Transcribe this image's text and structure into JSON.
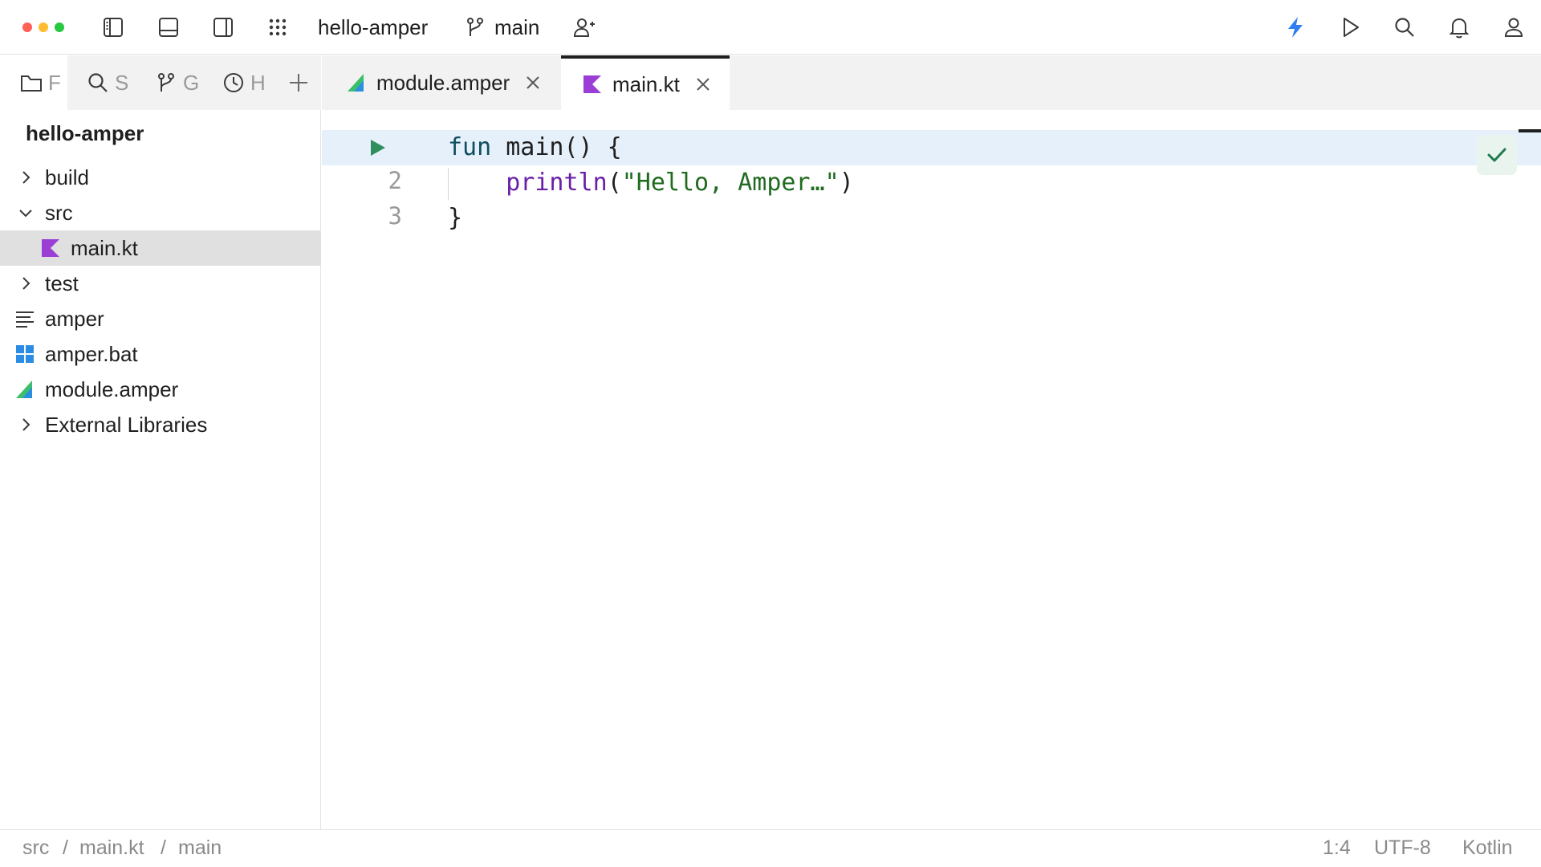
{
  "titlebar": {
    "project_name": "hello-amper",
    "branch": "main",
    "traffic_colors": [
      "#ff5f57",
      "#febc2e",
      "#28c840"
    ],
    "icons": [
      "toggle-left-panel-icon",
      "toggle-bottom-panel-icon",
      "toggle-right-panel-icon",
      "main-menu-grid-icon",
      "git-branch-icon",
      "add-user-icon",
      "ai-lightning-icon",
      "run-icon",
      "search-icon",
      "notifications-bell-icon",
      "account-icon"
    ],
    "accent_color": "#2f7ff2"
  },
  "tool_window_tabs": [
    {
      "label": "F",
      "icon": "folder-icon"
    },
    {
      "label": "S",
      "icon": "search-icon"
    },
    {
      "label": "G",
      "icon": "git-icon"
    },
    {
      "label": "H",
      "icon": "history-clock-icon"
    }
  ],
  "project_tree": {
    "title": "hello-amper",
    "items": [
      {
        "label": "build",
        "icon": "chevron-right-icon"
      },
      {
        "label": "src",
        "icon": "chevron-down-icon"
      },
      {
        "label": "main.kt",
        "icon": "kotlin-file-icon"
      },
      {
        "label": "test",
        "icon": "chevron-right-icon"
      },
      {
        "label": "amper",
        "icon": "text-file-icon"
      },
      {
        "label": "amper.bat",
        "icon": "windows-file-icon"
      },
      {
        "label": "module.amper",
        "icon": "amper-file-icon"
      },
      {
        "label": "External Libraries",
        "icon": "chevron-right-icon"
      }
    ]
  },
  "editor_tabs": [
    {
      "label": "module.amper",
      "icon": "amper-file-icon",
      "active": false
    },
    {
      "label": "main.kt",
      "icon": "kotlin-file-icon",
      "active": true
    }
  ],
  "editor": {
    "line_numbers": [
      "2",
      "3"
    ],
    "line1": {
      "kw": "fun",
      "rest": " main() {"
    },
    "line2": {
      "indent": "    ",
      "call": "println",
      "open": "(",
      "str": "\"Hello, Amper…\"",
      "close": ")"
    },
    "line3": "}"
  },
  "statusbar": {
    "breadcrumb": [
      "src",
      "main.kt",
      "main"
    ],
    "separator": "/",
    "position": "1:4",
    "encoding": "UTF-8",
    "language": "Kotlin"
  }
}
